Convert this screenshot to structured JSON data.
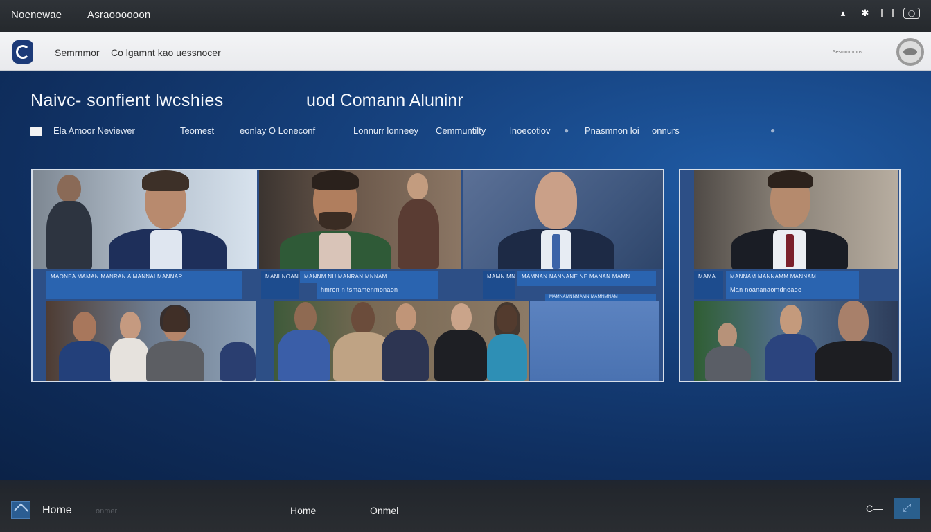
{
  "topbar": {
    "left_title": "Noenewae",
    "app_title": "Asraoooooon",
    "icons": [
      "chevron-up-icon",
      "settings-icon",
      "divider-icon",
      "window-icon"
    ]
  },
  "header": {
    "nav_item_1": "Semmmor",
    "nav_item_2": "Co lgamnt kao uessnocer",
    "right_label": "Sesmmmmos"
  },
  "main": {
    "title_left": "Naivc- sonfient lwcshies",
    "title_right": "uod Comann Aluninr",
    "filters": [
      "Ela Amoor Neviewer",
      "Teomest",
      "eonlay O Loneconf",
      "Lonnurr lonneey",
      "Cemmuntilty",
      "lnoecotiov",
      "Pnasmnon loi",
      "onnurs"
    ],
    "cards": [
      {
        "strip_top": "MAONEA   MAMAN MANRAN A   MANNAI MANNAR",
        "strip_mid_1": "MANI NOAN",
        "strip_mid_2": "MANNM NU MANRAN MNNAM",
        "strip_sub": "hmren n tsmamenmonaon",
        "strip_right_1": "MAMN  MN",
        "strip_right_2": "MAMNAN NANNANE  NE  MANAN MAMN",
        "strip_right_sub": "MAMNAMNNMAMN MAMNMNAM"
      },
      {
        "strip_top_1": "MAMA",
        "strip_top_2": "MANNAM MANNAMM MANNAM",
        "strip_sub": "Man noananaomdneaoe"
      }
    ]
  },
  "bottom": {
    "home_label": "Home",
    "ghost_label": "onmer",
    "link_1": "Home",
    "link_2": "Onmel",
    "right_key": "C—",
    "right_icon": "expand-icon"
  },
  "colors": {
    "accent": "#1c3a78",
    "main_bg": "#16427f",
    "strip": "#2a64b0"
  }
}
